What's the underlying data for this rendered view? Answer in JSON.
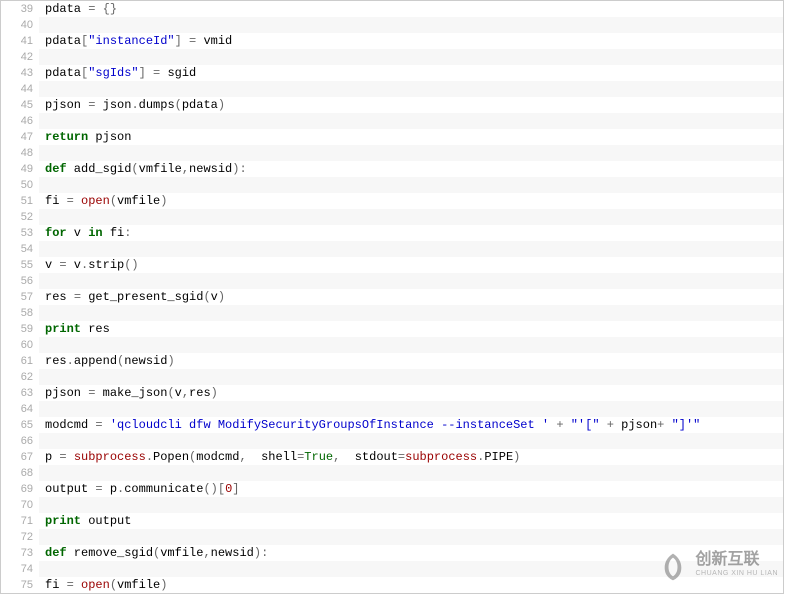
{
  "lines": [
    {
      "n": 39,
      "tokens": [
        {
          "t": "pdata ",
          "c": ""
        },
        {
          "t": "=",
          "c": "op"
        },
        {
          "t": " ",
          "c": ""
        },
        {
          "t": "{}",
          "c": "op"
        }
      ]
    },
    {
      "n": 40,
      "tokens": []
    },
    {
      "n": 41,
      "tokens": [
        {
          "t": "pdata",
          "c": ""
        },
        {
          "t": "[",
          "c": "op"
        },
        {
          "t": "\"instanceId\"",
          "c": "str"
        },
        {
          "t": "]",
          "c": "op"
        },
        {
          "t": " ",
          "c": ""
        },
        {
          "t": "=",
          "c": "op"
        },
        {
          "t": " vmid",
          "c": ""
        }
      ]
    },
    {
      "n": 42,
      "tokens": []
    },
    {
      "n": 43,
      "tokens": [
        {
          "t": "pdata",
          "c": ""
        },
        {
          "t": "[",
          "c": "op"
        },
        {
          "t": "\"sgIds\"",
          "c": "str"
        },
        {
          "t": "]",
          "c": "op"
        },
        {
          "t": " ",
          "c": ""
        },
        {
          "t": "=",
          "c": "op"
        },
        {
          "t": " sgid",
          "c": ""
        }
      ]
    },
    {
      "n": 44,
      "tokens": []
    },
    {
      "n": 45,
      "tokens": [
        {
          "t": "pjson ",
          "c": ""
        },
        {
          "t": "=",
          "c": "op"
        },
        {
          "t": " json",
          "c": ""
        },
        {
          "t": ".",
          "c": "op"
        },
        {
          "t": "dumps",
          "c": ""
        },
        {
          "t": "(",
          "c": "op"
        },
        {
          "t": "pdata",
          "c": ""
        },
        {
          "t": ")",
          "c": "op"
        }
      ]
    },
    {
      "n": 46,
      "tokens": []
    },
    {
      "n": 47,
      "tokens": [
        {
          "t": "return",
          "c": "kw"
        },
        {
          "t": " pjson",
          "c": ""
        }
      ]
    },
    {
      "n": 48,
      "tokens": []
    },
    {
      "n": 49,
      "tokens": [
        {
          "t": "def",
          "c": "kw"
        },
        {
          "t": " add_sgid",
          "c": ""
        },
        {
          "t": "(",
          "c": "op"
        },
        {
          "t": "vmfile",
          "c": ""
        },
        {
          "t": ",",
          "c": "op"
        },
        {
          "t": "newsid",
          "c": ""
        },
        {
          "t": "):",
          "c": "op"
        }
      ]
    },
    {
      "n": 50,
      "tokens": []
    },
    {
      "n": 51,
      "tokens": [
        {
          "t": "fi ",
          "c": ""
        },
        {
          "t": "=",
          "c": "op"
        },
        {
          "t": " ",
          "c": ""
        },
        {
          "t": "open",
          "c": "builtin"
        },
        {
          "t": "(",
          "c": "op"
        },
        {
          "t": "vmfile",
          "c": ""
        },
        {
          "t": ")",
          "c": "op"
        }
      ]
    },
    {
      "n": 52,
      "tokens": []
    },
    {
      "n": 53,
      "tokens": [
        {
          "t": "for",
          "c": "kw"
        },
        {
          "t": " v ",
          "c": ""
        },
        {
          "t": "in",
          "c": "kw"
        },
        {
          "t": " fi",
          "c": ""
        },
        {
          "t": ":",
          "c": "op"
        }
      ]
    },
    {
      "n": 54,
      "tokens": []
    },
    {
      "n": 55,
      "tokens": [
        {
          "t": "v ",
          "c": ""
        },
        {
          "t": "=",
          "c": "op"
        },
        {
          "t": " v",
          "c": ""
        },
        {
          "t": ".",
          "c": "op"
        },
        {
          "t": "strip",
          "c": ""
        },
        {
          "t": "()",
          "c": "op"
        }
      ]
    },
    {
      "n": 56,
      "tokens": []
    },
    {
      "n": 57,
      "tokens": [
        {
          "t": "res ",
          "c": ""
        },
        {
          "t": "=",
          "c": "op"
        },
        {
          "t": " get_present_sgid",
          "c": ""
        },
        {
          "t": "(",
          "c": "op"
        },
        {
          "t": "v",
          "c": ""
        },
        {
          "t": ")",
          "c": "op"
        }
      ]
    },
    {
      "n": 58,
      "tokens": []
    },
    {
      "n": 59,
      "tokens": [
        {
          "t": "print",
          "c": "kw"
        },
        {
          "t": " res",
          "c": ""
        }
      ]
    },
    {
      "n": 60,
      "tokens": []
    },
    {
      "n": 61,
      "tokens": [
        {
          "t": "res",
          "c": ""
        },
        {
          "t": ".",
          "c": "op"
        },
        {
          "t": "append",
          "c": ""
        },
        {
          "t": "(",
          "c": "op"
        },
        {
          "t": "newsid",
          "c": ""
        },
        {
          "t": ")",
          "c": "op"
        }
      ]
    },
    {
      "n": 62,
      "tokens": []
    },
    {
      "n": 63,
      "tokens": [
        {
          "t": "pjson ",
          "c": ""
        },
        {
          "t": "=",
          "c": "op"
        },
        {
          "t": " make_json",
          "c": ""
        },
        {
          "t": "(",
          "c": "op"
        },
        {
          "t": "v",
          "c": ""
        },
        {
          "t": ",",
          "c": "op"
        },
        {
          "t": "res",
          "c": ""
        },
        {
          "t": ")",
          "c": "op"
        }
      ]
    },
    {
      "n": 64,
      "tokens": []
    },
    {
      "n": 65,
      "tokens": [
        {
          "t": "modcmd ",
          "c": ""
        },
        {
          "t": "=",
          "c": "op"
        },
        {
          "t": " ",
          "c": ""
        },
        {
          "t": "'qcloudcli dfw ModifySecurityGroupsOfInstance --instanceSet '",
          "c": "str"
        },
        {
          "t": " ",
          "c": ""
        },
        {
          "t": "+",
          "c": "op"
        },
        {
          "t": " ",
          "c": ""
        },
        {
          "t": "\"'[\"",
          "c": "str"
        },
        {
          "t": " ",
          "c": ""
        },
        {
          "t": "+",
          "c": "op"
        },
        {
          "t": " pjson",
          "c": ""
        },
        {
          "t": "+",
          "c": "op"
        },
        {
          "t": " ",
          "c": ""
        },
        {
          "t": "\"]'\"",
          "c": "str"
        }
      ]
    },
    {
      "n": 66,
      "tokens": []
    },
    {
      "n": 67,
      "tokens": [
        {
          "t": "p ",
          "c": ""
        },
        {
          "t": "=",
          "c": "op"
        },
        {
          "t": " ",
          "c": ""
        },
        {
          "t": "subprocess",
          "c": "subproc"
        },
        {
          "t": ".",
          "c": "op"
        },
        {
          "t": "Popen",
          "c": ""
        },
        {
          "t": "(",
          "c": "op"
        },
        {
          "t": "modcmd",
          "c": ""
        },
        {
          "t": ",",
          "c": "op"
        },
        {
          "t": "  shell",
          "c": ""
        },
        {
          "t": "=",
          "c": "op"
        },
        {
          "t": "True",
          "c": "bool"
        },
        {
          "t": ",",
          "c": "op"
        },
        {
          "t": "  stdout",
          "c": ""
        },
        {
          "t": "=",
          "c": "op"
        },
        {
          "t": "subprocess",
          "c": "subproc"
        },
        {
          "t": ".",
          "c": "op"
        },
        {
          "t": "PIPE",
          "c": ""
        },
        {
          "t": ")",
          "c": "op"
        }
      ]
    },
    {
      "n": 68,
      "tokens": []
    },
    {
      "n": 69,
      "tokens": [
        {
          "t": "output ",
          "c": ""
        },
        {
          "t": "=",
          "c": "op"
        },
        {
          "t": " p",
          "c": ""
        },
        {
          "t": ".",
          "c": "op"
        },
        {
          "t": "communicate",
          "c": ""
        },
        {
          "t": "()",
          "c": "op"
        },
        {
          "t": "[",
          "c": "op"
        },
        {
          "t": "0",
          "c": "num"
        },
        {
          "t": "]",
          "c": "op"
        }
      ]
    },
    {
      "n": 70,
      "tokens": []
    },
    {
      "n": 71,
      "tokens": [
        {
          "t": "print",
          "c": "kw"
        },
        {
          "t": " output",
          "c": ""
        }
      ]
    },
    {
      "n": 72,
      "tokens": []
    },
    {
      "n": 73,
      "tokens": [
        {
          "t": "def",
          "c": "kw"
        },
        {
          "t": " remove_sgid",
          "c": ""
        },
        {
          "t": "(",
          "c": "op"
        },
        {
          "t": "vmfile",
          "c": ""
        },
        {
          "t": ",",
          "c": "op"
        },
        {
          "t": "newsid",
          "c": ""
        },
        {
          "t": "):",
          "c": "op"
        }
      ]
    },
    {
      "n": 74,
      "tokens": []
    },
    {
      "n": 75,
      "tokens": [
        {
          "t": "fi ",
          "c": ""
        },
        {
          "t": "=",
          "c": "op"
        },
        {
          "t": " ",
          "c": ""
        },
        {
          "t": "open",
          "c": "builtin"
        },
        {
          "t": "(",
          "c": "op"
        },
        {
          "t": "vmfile",
          "c": ""
        },
        {
          "t": ")",
          "c": "op"
        }
      ]
    }
  ],
  "watermark": {
    "cn": "创新互联",
    "en": "CHUANG XIN HU LIAN"
  }
}
